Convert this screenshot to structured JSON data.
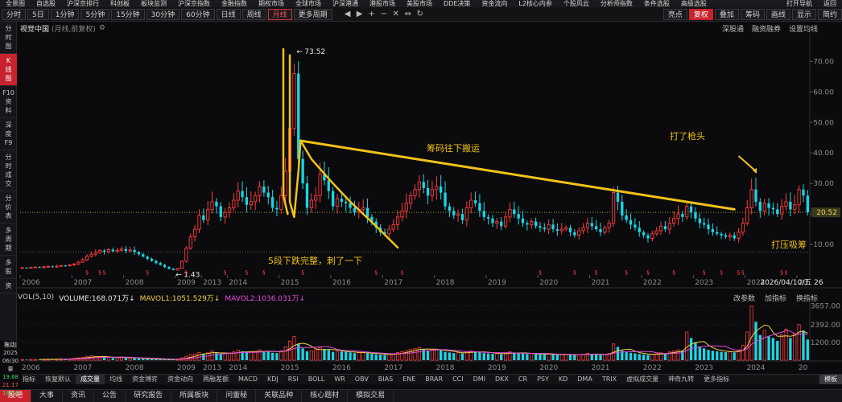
{
  "top_menu": [
    "全景图",
    "自选股",
    "沪深京排行",
    "科创板",
    "板块监测",
    "沪深京指数",
    "金融指数",
    "期权市场",
    "全球市场",
    "沪深港通",
    "港股市场",
    "美股市场",
    "DDE决策",
    "资金流向",
    "L2核心内参",
    "个股风云",
    "分析师指数",
    "条件选股",
    "高级选股"
  ],
  "top_menu_right": [
    "打开导航",
    "返回"
  ],
  "toolbar": {
    "periods": [
      "分时",
      "5日",
      "1分钟",
      "5分钟",
      "15分钟",
      "30分钟",
      "60分钟",
      "日线",
      "周线",
      "月线",
      "更多周期"
    ],
    "active_period": "月线",
    "right_items": [
      "亮点",
      "复权",
      "叠加",
      "筹码",
      "画线",
      "显示",
      "简约"
    ],
    "fq_label": "复权"
  },
  "sidebar": [
    {
      "label": "分\n时\n图",
      "active": false
    },
    {
      "label": "K\n线\n图",
      "active": true
    },
    {
      "label": "F10\n资\n料",
      "active": false
    },
    {
      "label": "深\n度\nF9",
      "active": false
    },
    {
      "label": "分\n时\n成\n交",
      "active": false
    },
    {
      "label": "分\n价\n表",
      "active": false
    },
    {
      "label": "多\n周\n期",
      "active": false
    },
    {
      "label": "多\n股",
      "active": false
    },
    {
      "label": "资",
      "active": false
    }
  ],
  "chart_header": {
    "stock_name": "视觉中国",
    "period_note": "(月线,前复权)",
    "links": [
      "深股通",
      "融资融券",
      "设置均线"
    ]
  },
  "vol_header": {
    "label": "VOL(5,10)",
    "volume": "VOLUME:168.071万↓",
    "mavol1": "MAVOL1:1051.529万↓",
    "mavol2": "MAVOL2:1036.031万↓",
    "right_links": [
      "改参数",
      "加指标",
      "换指标"
    ]
  },
  "data_panel": {
    "title": "拖动|",
    "date": "2025\n06/30",
    "items": [
      {
        "label": "量",
        "value": "19.68",
        "color": "green"
      },
      {
        "label": "",
        "value": "21.17",
        "color": "red"
      },
      {
        "label": "",
        "value": "18.74",
        "color": "green"
      }
    ]
  },
  "indicator_tabs": [
    "指标",
    "恢复默认",
    "成交量",
    "均线",
    "资金博弈",
    "资金动向",
    "两融差额",
    "MACD",
    "KDJ",
    "RSI",
    "BOLL",
    "WR",
    "OBV",
    "BIAS",
    "ENE",
    "BRAR",
    "CCI",
    "DMI",
    "DKX",
    "CR",
    "PSY",
    "KD",
    "DMA",
    "TRIX",
    "虚拟成交量",
    "神奇九转",
    "更多指标",
    "模板"
  ],
  "indicator_active": "成交量",
  "bottom_bar": [
    "股吧",
    "大事",
    "资讯",
    "公告",
    "研究报告",
    "所属板块",
    "问董秘",
    "关联品种",
    "核心题材",
    "模拟交易"
  ],
  "annotations": {
    "peak": "73.52",
    "low": "1.43",
    "trend": "筹码往下搬运",
    "wave": "5段下跌完整，刺了一下",
    "needle": "打了枪头",
    "suppress": "打压吸筹",
    "last_price": "20.52",
    "cursor_date": "2026/04/10/五 26"
  },
  "colors": {
    "up": "#ff3b3b",
    "down": "#19d6e6",
    "annotation": "#f2c21a",
    "ma1": "#ffffff",
    "ma2": "#e24ce0"
  },
  "chart_data": {
    "type": "candlestick",
    "title": "视觉中国",
    "y_axis": {
      "ticks": [
        10,
        20,
        30,
        40,
        50,
        60,
        70
      ],
      "labels": [
        "10.00",
        "20.00",
        "30.00",
        "40.00",
        "50.00",
        "60.00",
        "70.00"
      ],
      "range": [
        0,
        78
      ]
    },
    "x_labels": [
      {
        "label": "2006",
        "i": 0
      },
      {
        "label": "2007",
        "i": 12
      },
      {
        "label": "2008",
        "i": 24
      },
      {
        "label": "2009",
        "i": 36
      },
      {
        "label": "2013",
        "i": 42
      },
      {
        "label": "2014",
        "i": 48
      },
      {
        "label": "2015",
        "i": 60
      },
      {
        "label": "2016",
        "i": 72
      },
      {
        "label": "2017",
        "i": 84
      },
      {
        "label": "2018",
        "i": 96
      },
      {
        "label": "2019",
        "i": 108
      },
      {
        "label": "2020",
        "i": 120
      },
      {
        "label": "2021",
        "i": 132
      },
      {
        "label": "2022",
        "i": 144
      },
      {
        "label": "2023",
        "i": 156
      },
      {
        "label": "2024",
        "i": 168
      },
      {
        "label": "20",
        "i": 180
      }
    ],
    "closes": [
      2.4,
      2.3,
      2.5,
      2.6,
      2.4,
      2.7,
      2.8,
      2.6,
      2.9,
      3.1,
      3.0,
      3.3,
      3.6,
      4.2,
      5.0,
      6.1,
      6.8,
      7.4,
      8.0,
      7.6,
      8.3,
      7.8,
      8.1,
      8.5,
      7.9,
      8.2,
      7.5,
      6.8,
      6.0,
      5.3,
      4.6,
      3.9,
      3.3,
      2.6,
      2.0,
      1.6,
      2.2,
      4.5,
      8.8,
      12.5,
      15.0,
      19.5,
      18.0,
      21.5,
      24.0,
      22.5,
      19.0,
      20.5,
      22.0,
      24.5,
      27.5,
      25.5,
      23.0,
      24.0,
      26.0,
      29.0,
      27.0,
      25.5,
      22.0,
      21.5,
      26.0,
      34.0,
      48.0,
      66.0,
      38.0,
      30.0,
      22.0,
      24.5,
      26.0,
      33.0,
      31.0,
      27.5,
      22.5,
      25.0,
      24.0,
      23.5,
      22.0,
      20.5,
      21.5,
      22.0,
      19.0,
      17.5,
      15.5,
      14.0,
      13.5,
      15.0,
      16.5,
      19.0,
      21.0,
      23.5,
      26.0,
      28.0,
      30.5,
      28.5,
      26.0,
      28.0,
      29.0,
      27.0,
      22.5,
      21.0,
      19.5,
      20.0,
      18.0,
      22.0,
      24.5,
      23.5,
      21.0,
      19.0,
      18.5,
      17.0,
      17.5,
      16.0,
      19.0,
      21.5,
      20.0,
      18.5,
      17.0,
      16.5,
      17.5,
      16.0,
      15.5,
      15.0,
      16.5,
      15.0,
      14.5,
      15.0,
      15.5,
      14.0,
      13.0,
      14.5,
      15.5,
      17.0,
      16.0,
      15.0,
      14.0,
      15.5,
      17.0,
      27.0,
      24.0,
      19.5,
      18.0,
      16.5,
      15.5,
      14.0,
      13.0,
      12.0,
      13.5,
      14.5,
      16.0,
      15.0,
      17.0,
      18.5,
      20.0,
      19.0,
      22.5,
      20.5,
      18.5,
      17.0,
      16.5,
      15.0,
      14.0,
      13.5,
      13.0,
      12.5,
      13.0,
      12.0,
      14.0,
      17.0,
      22.0,
      28.0,
      24.0,
      21.0,
      23.5,
      22.0,
      21.5,
      20.0,
      22.5,
      24.0,
      21.5,
      23.0,
      28.0,
      26.0,
      20.52
    ],
    "volumes": [
      50,
      40,
      60,
      55,
      45,
      70,
      65,
      50,
      80,
      90,
      70,
      100,
      120,
      160,
      200,
      260,
      300,
      250,
      220,
      180,
      200,
      150,
      170,
      210,
      140,
      160,
      130,
      110,
      90,
      80,
      70,
      60,
      55,
      50,
      45,
      60,
      90,
      160,
      260,
      380,
      420,
      520,
      450,
      500,
      620,
      480,
      400,
      430,
      470,
      560,
      680,
      600,
      520,
      540,
      580,
      700,
      620,
      580,
      500,
      480,
      650,
      900,
      1300,
      1600,
      1100,
      800,
      600,
      640,
      700,
      850,
      760,
      680,
      560,
      600,
      580,
      560,
      520,
      480,
      500,
      520,
      460,
      430,
      400,
      380,
      360,
      400,
      440,
      520,
      580,
      650,
      720,
      780,
      860,
      740,
      660,
      700,
      740,
      680,
      560,
      520,
      480,
      500,
      460,
      560,
      620,
      600,
      540,
      480,
      460,
      430,
      440,
      400,
      480,
      560,
      520,
      480,
      440,
      420,
      450,
      410,
      400,
      380,
      420,
      380,
      370,
      380,
      400,
      360,
      340,
      380,
      410,
      460,
      420,
      380,
      360,
      400,
      450,
      1100,
      900,
      640,
      560,
      500,
      460,
      420,
      380,
      360,
      400,
      440,
      500,
      460,
      560,
      620,
      700,
      660,
      1900,
      1500,
      1200,
      900,
      800,
      700,
      640,
      600,
      560,
      540,
      560,
      520,
      700,
      1000,
      1900,
      3657,
      2600,
      1700,
      2000,
      1600,
      1500,
      1300,
      1700,
      2100,
      1500,
      1800,
      2400,
      2000,
      1400
    ],
    "vol_axis": {
      "ticks": [
        1200,
        2392,
        3657
      ],
      "labels": [
        "1200.00",
        "2392.00",
        "3657.00"
      ],
      "max": 3800
    },
    "series": []
  }
}
